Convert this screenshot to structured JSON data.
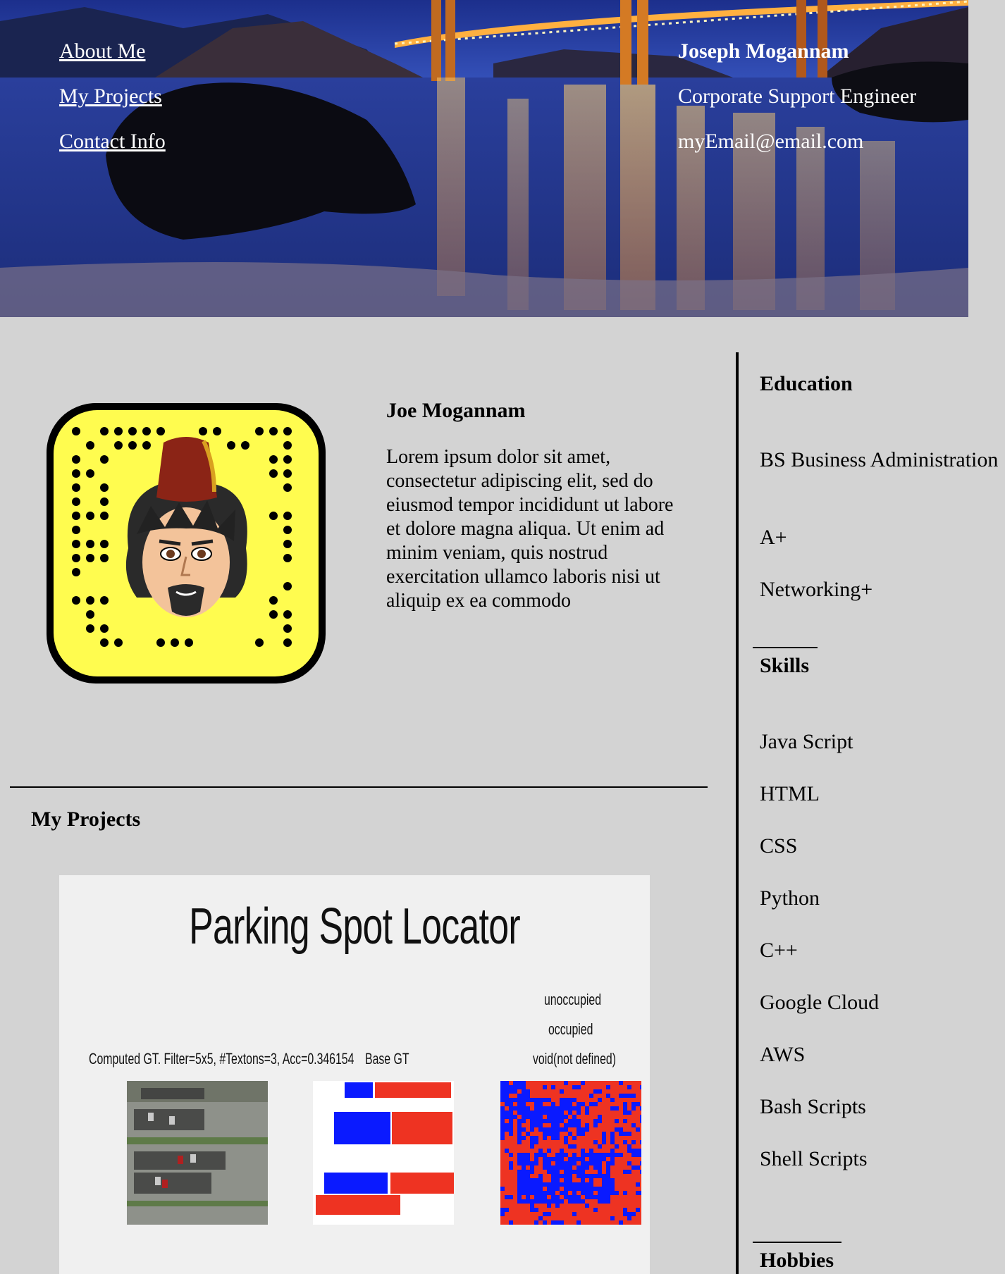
{
  "nav": {
    "about": "About Me",
    "projects": "My Projects",
    "contact": "Contact Info"
  },
  "contact": {
    "name": "Joseph Mogannam",
    "title": "Corporate Support Engineer",
    "email": "myEmail@email.com"
  },
  "profile": {
    "name": "Joe Mogannam",
    "bio": "Lorem ipsum dolor sit amet, consectetur adipiscing elit, sed do eiusmod tempor incididunt ut labore et dolore magna aliqua. Ut enim ad minim veniam, quis nostrud exercitation ullamco laboris nisi ut aliquip ex ea commodo"
  },
  "projects": {
    "heading": "My Projects",
    "card": {
      "title": "Parking Spot Locator",
      "label_computed": "Computed GT. Filter=5x5, #Textons=3, Acc=0.346154",
      "label_base": "Base GT",
      "legend_unoccupied": "unoccupied",
      "legend_occupied": "occupied",
      "legend_void": "void(not defined)"
    }
  },
  "sidebar": {
    "education": {
      "heading": "Education",
      "items": [
        "BS Business Administration",
        "A+",
        "Networking+"
      ]
    },
    "skills": {
      "heading": "Skills",
      "items": [
        "Java Script",
        "HTML",
        "CSS",
        "Python",
        "C++",
        "Google Cloud",
        "AWS",
        "Bash Scripts",
        "Shell Scripts"
      ]
    },
    "hobbies": {
      "heading": "Hobbies"
    }
  },
  "colors": {
    "page_bg": "#d3d3d3",
    "snap_yellow": "#fffc4f",
    "map_blue": "#0a1aff",
    "map_red": "#ee3322"
  }
}
